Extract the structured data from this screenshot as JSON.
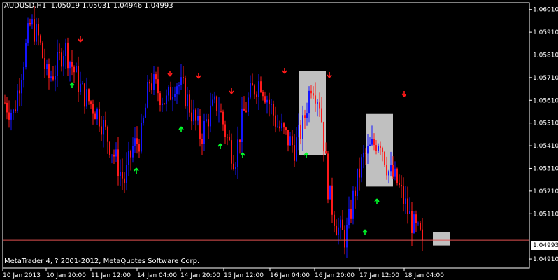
{
  "header": {
    "title": "AUDUSD,H1  1.05019 1.05031 1.04946 1.04993"
  },
  "footer": {
    "copyright": "MetaTrader 4, ? 2001-2012, MetaQuotes Software Corp."
  },
  "current_price": "1.04993",
  "colors": {
    "background": "#000000",
    "grid": "#ffffff",
    "bull_candle": "#1414ff",
    "bear_candle": "#ff1a1a",
    "up_arrow": "#00ff2a",
    "down_arrow": "#ff1a1a",
    "highlight_box": "#c0c0c0",
    "price_line": "#e05050"
  },
  "chart_data": {
    "type": "candlestick",
    "symbol": "AUDUSD",
    "timeframe": "H1",
    "ylim": [
      1.0487,
      1.0604
    ],
    "y_ticks": [
      "1.06010",
      "1.05910",
      "1.05810",
      "1.05710",
      "1.05610",
      "1.05510",
      "1.05410",
      "1.05310",
      "1.05210",
      "1.05110",
      "1.04910"
    ],
    "x_ticks": [
      "10 Jan 2013",
      "10 Jan 20:00",
      "11 Jan 12:00",
      "14 Jan 04:00",
      "14 Jan 20:00",
      "15 Jan 12:00",
      "16 Jan 04:00",
      "16 Jan 20:00",
      "17 Jan 12:00",
      "18 Jan 04:00"
    ],
    "last": {
      "open": 1.05019,
      "high": 1.05031,
      "low": 1.04946,
      "close": 1.04993
    },
    "anchors": [
      1.056,
      1.0555,
      1.0575,
      1.0595,
      1.0588,
      1.057,
      1.0575,
      1.0585,
      1.0575,
      1.0565,
      1.056,
      1.0555,
      1.0545,
      1.0535,
      1.0525,
      1.054,
      1.0545,
      1.057,
      1.0565,
      1.056,
      1.057,
      1.0565,
      1.0555,
      1.0545,
      1.0555,
      1.056,
      1.0545,
      1.0535,
      1.0555,
      1.0565,
      1.057,
      1.056,
      1.055,
      1.0545,
      1.054,
      1.055,
      1.057,
      1.056,
      1.052,
      1.0505,
      1.05,
      1.052,
      1.0535,
      1.054,
      1.0545,
      1.053,
      1.0525,
      1.0515,
      1.0505,
      1.0499
    ],
    "up_arrows": [
      {
        "x": 103
      },
      {
        "x": 195
      },
      {
        "x": 259
      },
      {
        "x": 315
      },
      {
        "x": 347
      },
      {
        "x": 438
      },
      {
        "x": 522
      },
      {
        "x": 539
      }
    ],
    "down_arrows": [
      {
        "x": 115
      },
      {
        "x": 243
      },
      {
        "x": 284
      },
      {
        "x": 331
      },
      {
        "x": 407
      },
      {
        "x": 471
      },
      {
        "x": 578
      }
    ],
    "highlight_boxes": [
      {
        "from": 1.0574,
        "to": 1.0537
      },
      {
        "from": 1.0555,
        "to": 1.0523
      },
      {
        "from": 1.0503,
        "to": 1.0497
      }
    ]
  }
}
